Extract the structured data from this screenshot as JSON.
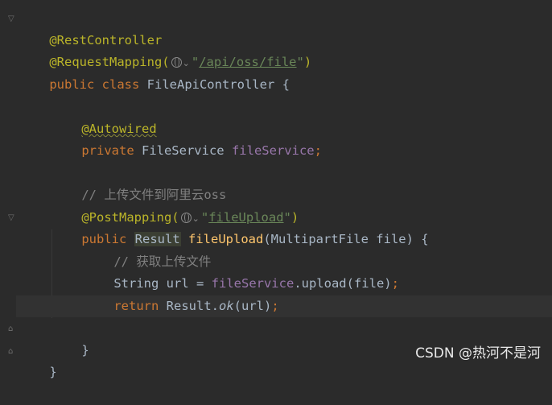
{
  "editor": {
    "lines": {
      "l1": "@RestController",
      "l2_ann": "@RequestMapping(",
      "l2_str": "\"/api/oss/file\"",
      "l2_end": ")",
      "l3_kw": "public class ",
      "l3_name": "FileApiController {",
      "l5": "@Autowired",
      "l6_kw": "private ",
      "l6_type": "FileService ",
      "l6_field": "fileService",
      "l6_semi": ";",
      "l8": "// 上传文件到阿里云oss",
      "l9_ann": "@PostMapping(",
      "l9_str_q1": "\"",
      "l9_str": "fileUpload",
      "l9_str_q2": "\"",
      "l9_end": ")",
      "l10_kw": "public ",
      "l10_type": "Result",
      "l10_fn": "fileUpload",
      "l10_params": "(MultipartFile file) {",
      "l11": "// 获取上传文件",
      "l12_a": "String url = ",
      "l12_field": "fileService",
      "l12_b": ".upload(file)",
      "l12_semi": ";",
      "l13_kw": "return ",
      "l13_a": "Result.",
      "l13_ok": "ok",
      "l13_b": "(url)",
      "l13_semi": ";",
      "l15": "}",
      "l16": "}"
    },
    "icons": {
      "globe": "globe-icon",
      "chevron": "chevron-down-icon",
      "fold": "fold-marker-icon"
    },
    "glyphs": {
      "chevron": "⌄",
      "fold_open": "▽",
      "fold_close": "⌂"
    }
  },
  "watermark": "CSDN @热河不是河",
  "colors": {
    "background": "#2b2b2b",
    "annotation": "#bbb529",
    "keyword": "#cc7832",
    "string": "#6a8759",
    "field": "#9876aa",
    "function": "#ffc66d",
    "comment": "#808080",
    "text": "#a9b7c6"
  }
}
